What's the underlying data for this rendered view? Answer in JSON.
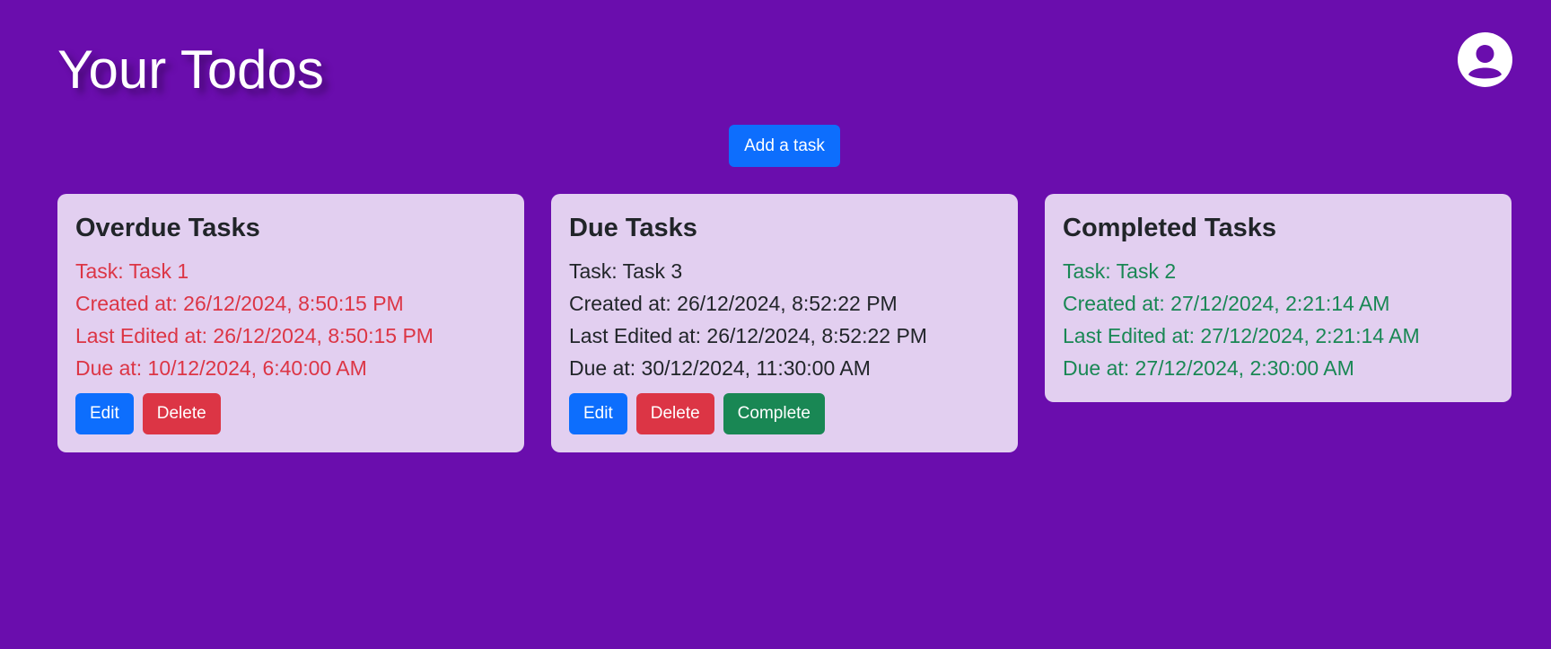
{
  "header": {
    "title": "Your Todos",
    "avatar_icon": "user-circle-icon"
  },
  "toolbar": {
    "add_label": "Add a task"
  },
  "colors": {
    "background": "#6a0dad",
    "card": "#e2cff0",
    "primary": "#0d6efd",
    "danger": "#dc3545",
    "success": "#198754"
  },
  "columns": [
    {
      "title": "Overdue Tasks",
      "status": "overdue",
      "task": {
        "name": "Task: Task 1",
        "created": "Created at: 26/12/2024, 8:50:15 PM",
        "edited": "Last Edited at: 26/12/2024, 8:50:15 PM",
        "due": "Due at: 10/12/2024, 6:40:00 AM"
      },
      "actions": [
        "Edit",
        "Delete"
      ]
    },
    {
      "title": "Due Tasks",
      "status": "due",
      "task": {
        "name": "Task: Task 3",
        "created": "Created at: 26/12/2024, 8:52:22 PM",
        "edited": "Last Edited at: 26/12/2024, 8:52:22 PM",
        "due": "Due at: 30/12/2024, 11:30:00 AM"
      },
      "actions": [
        "Edit",
        "Delete",
        "Complete"
      ]
    },
    {
      "title": "Completed Tasks",
      "status": "completed",
      "task": {
        "name": "Task: Task 2",
        "created": "Created at: 27/12/2024, 2:21:14 AM",
        "edited": "Last Edited at: 27/12/2024, 2:21:14 AM",
        "due": "Due at: 27/12/2024, 2:30:00 AM"
      },
      "actions": []
    }
  ]
}
